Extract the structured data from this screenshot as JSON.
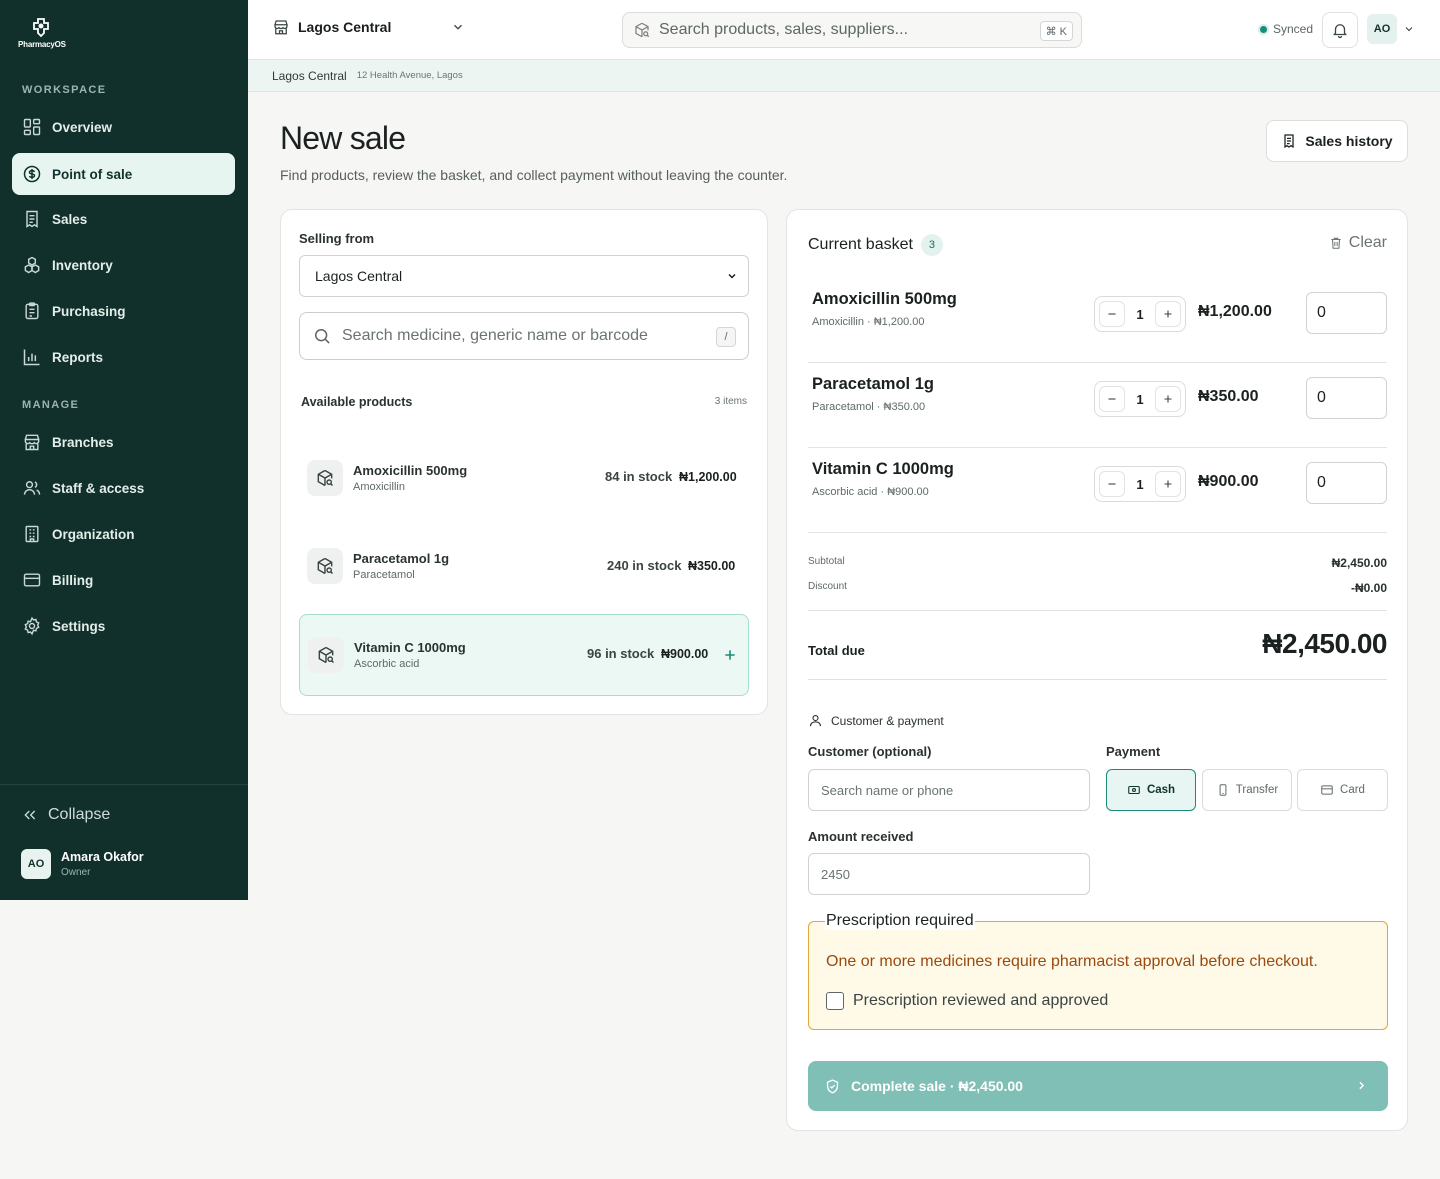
{
  "app": {
    "logo_text": "PharmacyOS"
  },
  "sidebar": {
    "workspace_label": "WORKSPACE",
    "manage_label": "MANAGE",
    "workspace_items": [
      {
        "label": "Overview",
        "icon": "grid-icon"
      },
      {
        "label": "Point of sale",
        "icon": "dollar-icon",
        "active": true
      },
      {
        "label": "Sales",
        "icon": "receipt-icon"
      },
      {
        "label": "Inventory",
        "icon": "boxes-icon"
      },
      {
        "label": "Purchasing",
        "icon": "clipboard-icon"
      },
      {
        "label": "Reports",
        "icon": "bar-chart-icon"
      }
    ],
    "manage_items": [
      {
        "label": "Branches",
        "icon": "store-icon"
      },
      {
        "label": "Staff & access",
        "icon": "users-icon"
      },
      {
        "label": "Organization",
        "icon": "building-icon"
      },
      {
        "label": "Billing",
        "icon": "card-icon"
      },
      {
        "label": "Settings",
        "icon": "gear-icon"
      }
    ],
    "collapse_label": "Collapse",
    "user": {
      "initials": "AO",
      "name": "Amara Okafor",
      "role": "Owner"
    }
  },
  "topbar": {
    "branch": "Lagos Central",
    "search_placeholder": "Search products, sales, suppliers...",
    "shortcut": "⌘ K",
    "sync_status": "Synced",
    "avatar_initials": "AO"
  },
  "breadcrumb": {
    "branch": "Lagos Central",
    "address": "12 Health Avenue, Lagos"
  },
  "page": {
    "title": "New sale",
    "subtitle": "Find products, review the basket, and collect payment without leaving the counter.",
    "history_button": "Sales history"
  },
  "products": {
    "selling_from_label": "Selling from",
    "selling_from_value": "Lagos Central",
    "search_placeholder": "Search medicine, generic name or barcode",
    "search_shortcut": "/",
    "heading": "Available products",
    "count": "3 items",
    "items": [
      {
        "name": "Amoxicillin 500mg",
        "generic": "Amoxicillin",
        "stock": "84 in stock",
        "price": "₦1,200.00"
      },
      {
        "name": "Paracetamol 1g",
        "generic": "Paracetamol",
        "stock": "240 in stock",
        "price": "₦350.00"
      },
      {
        "name": "Vitamin C 1000mg",
        "generic": "Ascorbic acid",
        "stock": "96 in stock",
        "price": "₦900.00"
      }
    ]
  },
  "basket": {
    "title": "Current basket",
    "count": "3",
    "clear_label": "Clear",
    "lines": [
      {
        "name": "Amoxicillin 500mg",
        "sub": "Amoxicillin · ₦1,200.00",
        "qty": "1",
        "price": "₦1,200.00",
        "discount": "0"
      },
      {
        "name": "Paracetamol 1g",
        "sub": "Paracetamol · ₦350.00",
        "qty": "1",
        "price": "₦350.00",
        "discount": "0"
      },
      {
        "name": "Vitamin C 1000mg",
        "sub": "Ascorbic acid · ₦900.00",
        "qty": "1",
        "price": "₦900.00",
        "discount": "0"
      }
    ],
    "subtotal_label": "Subtotal",
    "subtotal": "₦2,450.00",
    "discount_label": "Discount",
    "discount": "-₦0.00",
    "total_label": "Total due",
    "total": "₦2,450.00",
    "customer_payment_label": "Customer & payment",
    "customer_label": "Customer (optional)",
    "customer_placeholder": "Search name or phone",
    "payment_label": "Payment",
    "payment_methods": [
      "Cash",
      "Transfer",
      "Card"
    ],
    "selected_payment": "Cash",
    "amount_label": "Amount received",
    "amount_placeholder": "2450",
    "rx_title": "Prescription required",
    "rx_message": "One or more medicines require pharmacist approval before checkout.",
    "rx_checkbox": "Prescription reviewed and approved",
    "complete_button": "Complete sale · ₦2,450.00"
  }
}
